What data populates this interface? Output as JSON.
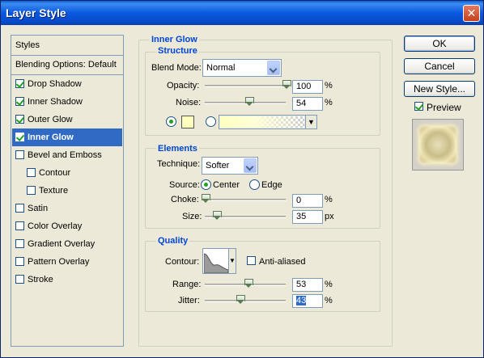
{
  "window": {
    "title": "Layer Style"
  },
  "styles": {
    "header": "Styles",
    "blending": "Blending Options: Default",
    "items": [
      {
        "label": "Drop Shadow",
        "checked": true,
        "indent": false,
        "selected": false
      },
      {
        "label": "Inner Shadow",
        "checked": true,
        "indent": false,
        "selected": false
      },
      {
        "label": "Outer Glow",
        "checked": true,
        "indent": false,
        "selected": false
      },
      {
        "label": "Inner Glow",
        "checked": true,
        "indent": false,
        "selected": true
      },
      {
        "label": "Bevel and Emboss",
        "checked": false,
        "indent": false,
        "selected": false
      },
      {
        "label": "Contour",
        "checked": false,
        "indent": true,
        "selected": false
      },
      {
        "label": "Texture",
        "checked": false,
        "indent": true,
        "selected": false
      },
      {
        "label": "Satin",
        "checked": false,
        "indent": false,
        "selected": false
      },
      {
        "label": "Color Overlay",
        "checked": false,
        "indent": false,
        "selected": false
      },
      {
        "label": "Gradient Overlay",
        "checked": false,
        "indent": false,
        "selected": false
      },
      {
        "label": "Pattern Overlay",
        "checked": false,
        "indent": false,
        "selected": false
      },
      {
        "label": "Stroke",
        "checked": false,
        "indent": false,
        "selected": false
      }
    ]
  },
  "inner_glow": {
    "title": "Inner Glow",
    "structure": {
      "title": "Structure",
      "blend_mode_label": "Blend Mode:",
      "blend_mode": "Normal",
      "opacity_label": "Opacity:",
      "opacity": "100",
      "opacity_pct": 100,
      "noise_label": "Noise:",
      "noise": "54",
      "noise_pct": 54,
      "unit": "%",
      "glow_color": "#FFFFC0",
      "color_mode": "solid"
    },
    "elements": {
      "title": "Elements",
      "technique_label": "Technique:",
      "technique": "Softer",
      "source_label": "Source:",
      "source_center": "Center",
      "source_edge": "Edge",
      "source_selected": "center",
      "choke_label": "Choke:",
      "choke": "0",
      "choke_pct": 0,
      "choke_unit": "%",
      "size_label": "Size:",
      "size": "35",
      "size_unit": "px",
      "size_pct": 14
    },
    "quality": {
      "title": "Quality",
      "contour_label": "Contour:",
      "anti_aliased_label": "Anti-aliased",
      "anti_aliased": false,
      "range_label": "Range:",
      "range": "53",
      "range_pct": 53,
      "jitter_label": "Jitter:",
      "jitter": "43",
      "jitter_pct": 43,
      "unit": "%"
    }
  },
  "buttons": {
    "ok": "OK",
    "cancel": "Cancel",
    "new_style": "New Style...",
    "preview_label": "Preview",
    "preview_checked": true
  },
  "icons": [
    "close-icon",
    "checkbox-icon",
    "dropdown-arrow-icon",
    "slider-thumb-icon",
    "contour-curve-icon"
  ],
  "colors": {
    "selection": "#316AC5",
    "group_title": "#0046D5",
    "titlebar": "#0A5FD8"
  }
}
